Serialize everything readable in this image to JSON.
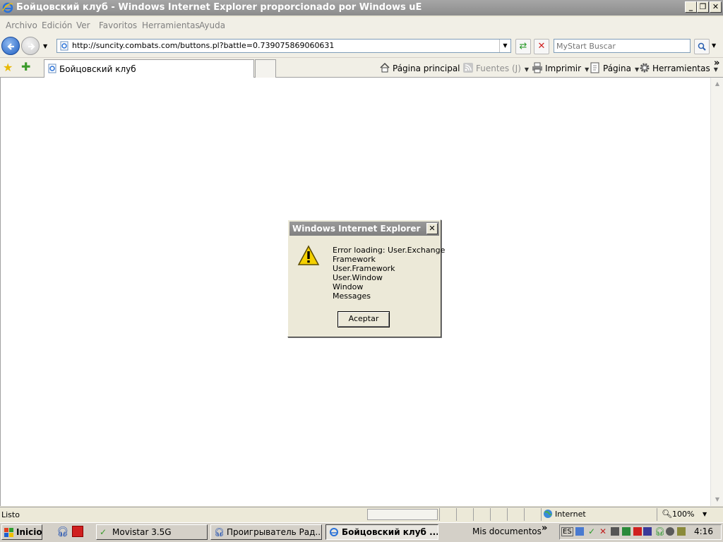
{
  "window": {
    "title": "Бойцовский клуб - Windows Internet Explorer proporcionado por Windows uE",
    "minimize": "_",
    "restore": "❐",
    "close": "✕"
  },
  "menu": {
    "items": [
      "Archivo",
      "Edición",
      "Ver",
      "Favoritos",
      "Herramientas",
      "Ayuda"
    ]
  },
  "address": {
    "url": "http://suncity.combats.com/buttons.pl?battle=0.739075869060631",
    "search_placeholder": "MyStart Buscar"
  },
  "tabs": {
    "active_label": "Бойцовский клуб"
  },
  "commands": {
    "home": "Página principal",
    "feeds": "Fuentes (J)",
    "print": "Imprimir",
    "page": "Página",
    "tools": "Herramientas",
    "more": "»"
  },
  "dialog": {
    "title": "Windows Internet Explorer",
    "close": "✕",
    "lines": [
      "Error loading: User.Exchange",
      "Framework",
      "User.Framework",
      "User.Window",
      "Window",
      "Messages"
    ],
    "ok_label": "Aceptar"
  },
  "status": {
    "text": "Listo",
    "zone": "Internet",
    "zoom": "100%"
  },
  "taskbar": {
    "start": "Inicio",
    "tasks": [
      "Movistar 3.5G",
      "Проигрыватель Рад...",
      "Бойцовский клуб ..."
    ],
    "folder": "Mis documentos",
    "more": "»",
    "clock": "4:16"
  },
  "colors": {
    "accent": "#1f5fc2",
    "inactive_title": "#8c8c8c",
    "warning": "#f4d000"
  }
}
